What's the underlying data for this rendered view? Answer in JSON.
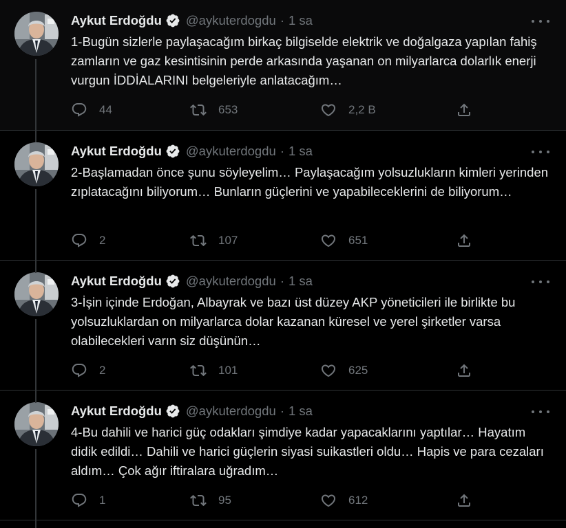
{
  "tweets": [
    {
      "author": "Aykut Erdoğdu",
      "handle": "@aykuterdogdu",
      "time": "1 sa",
      "text": "1-Bugün sizlerle paylaşacağım birkaç bilgiselde elektrik ve doğalgaza yapılan fahiş zamların ve gaz kesintisinin perde arkasında yaşanan on milyarlarca dolarlık enerji vurgun İDDİALARINI belgeleriyle anlatacağım…",
      "replies": "44",
      "retweets": "653",
      "likes": "2,2 B"
    },
    {
      "author": "Aykut Erdoğdu",
      "handle": "@aykuterdogdu",
      "time": "1 sa",
      "text": "2-Başlamadan önce şunu söyleyelim… Paylaşacağım yolsuzlukların kimleri yerinden zıplatacağını biliyorum… Bunların güçlerini ve yapabileceklerini de biliyorum…",
      "replies": "2",
      "retweets": "107",
      "likes": "651"
    },
    {
      "author": "Aykut Erdoğdu",
      "handle": "@aykuterdogdu",
      "time": "1 sa",
      "text": "3-İşin içinde Erdoğan, Albayrak ve bazı üst düzey AKP yöneticileri ile birlikte bu yolsuzluklardan on milyarlarca dolar kazanan küresel ve yerel şirketler varsa olabilecekleri varın siz düşünün…",
      "replies": "2",
      "retweets": "101",
      "likes": "625"
    },
    {
      "author": "Aykut Erdoğdu",
      "handle": "@aykuterdogdu",
      "time": "1 sa",
      "text": "4-Bu dahili ve harici güç odakları şimdiye kadar yapacaklarını yaptılar… Hayatım didik edildi… Dahili ve harici güçlerin siyasi suikastleri oldu… Hapis ve para cezaları aldım… Çok ağır iftiralara uğradım…",
      "replies": "1",
      "retweets": "95",
      "likes": "612"
    }
  ],
  "colors": {
    "background": "#000000",
    "text": "#e7e9ea",
    "muted": "#71767b",
    "thread_line": "#333639",
    "verified_badge": "#e7e9ea"
  },
  "icons": [
    "verified-icon",
    "more-icon",
    "reply-icon",
    "retweet-icon",
    "like-icon",
    "share-icon"
  ]
}
